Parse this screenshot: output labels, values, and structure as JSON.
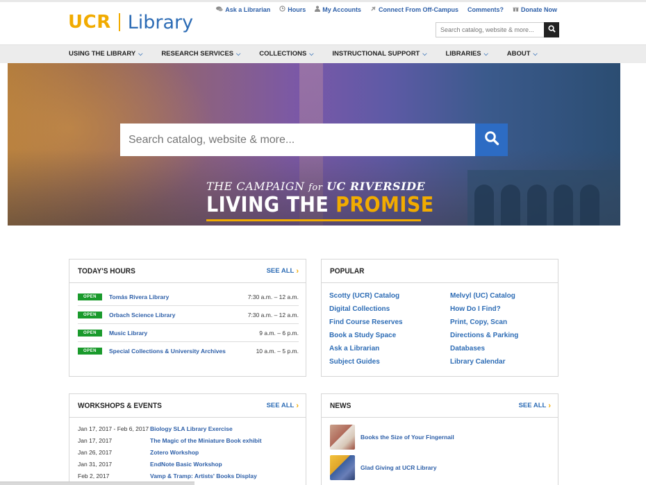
{
  "header": {
    "logo_ucr": "UCR",
    "logo_library": "Library",
    "utility_links": [
      {
        "label": "Ask a Librarian",
        "icon": "chat-bubbles-icon"
      },
      {
        "label": "Hours",
        "icon": "clock-icon"
      },
      {
        "label": "My Accounts",
        "icon": "user-icon"
      },
      {
        "label": "Connect From Off-Campus",
        "icon": "connect-icon"
      },
      {
        "label": "Comments?",
        "icon": ""
      },
      {
        "label": "Donate Now",
        "icon": "gift-icon"
      }
    ],
    "search_placeholder": "Search catalog, website & more..."
  },
  "nav": {
    "items": [
      {
        "label": "Using the Library"
      },
      {
        "label": "Research Services"
      },
      {
        "label": "Collections"
      },
      {
        "label": "Instructional Support"
      },
      {
        "label": "Libraries"
      },
      {
        "label": "About"
      }
    ]
  },
  "hero": {
    "search_placeholder": "Search catalog, website & more...",
    "campaign_prefix": "THE CAMPAIGN",
    "campaign_for": "for",
    "campaign_school": "UC RIVERSIDE",
    "tagline_white": "LIVING THE",
    "tagline_gold": "PROMISE"
  },
  "hours": {
    "title": "Today's Hours",
    "see_all": "SEE ALL",
    "rows": [
      {
        "status": "OPEN",
        "name": "Tomás Rivera Library",
        "time": "7:30 a.m. – 12 a.m."
      },
      {
        "status": "OPEN",
        "name": "Orbach Science Library",
        "time": "7:30 a.m. – 12 a.m."
      },
      {
        "status": "OPEN",
        "name": "Music Library",
        "time": "9 a.m. – 6 p.m."
      },
      {
        "status": "OPEN",
        "name": "Special Collections & University Archives",
        "time": "10 a.m. – 5 p.m."
      }
    ]
  },
  "popular": {
    "title": "Popular",
    "left": [
      "Scotty (UCR) Catalog",
      "Digital Collections",
      "Find Course Reserves",
      "Book a Study Space",
      "Ask a Librarian",
      "Subject Guides"
    ],
    "right": [
      "Melvyl (UC) Catalog",
      "How Do I Find?",
      "Print, Copy, Scan",
      "Directions & Parking",
      "Databases",
      "Library Calendar"
    ]
  },
  "workshops": {
    "title": "Workshops & Events",
    "see_all": "SEE ALL",
    "rows": [
      {
        "date": "Jan 17, 2017 - Feb 6, 2017",
        "name": "Biology SLA Library Exercise"
      },
      {
        "date": "Jan 17, 2017",
        "name": "The Magic of the Miniature Book exhibit"
      },
      {
        "date": "Jan 26, 2017",
        "name": "Zotero Workshop"
      },
      {
        "date": "Jan 31, 2017",
        "name": "EndNote Basic Workshop"
      },
      {
        "date": "Feb 2, 2017",
        "name": "Vamp & Tramp: Artists' Books Display"
      }
    ]
  },
  "news": {
    "title": "News",
    "see_all": "SEE ALL",
    "items": [
      {
        "title": "Books the Size of Your Fingernail"
      },
      {
        "title": "Glad Giving at UCR Library"
      }
    ]
  },
  "colors": {
    "brand_gold": "#f1ab00",
    "brand_blue": "#2d6cb5",
    "open_green": "#1a9a2c"
  }
}
